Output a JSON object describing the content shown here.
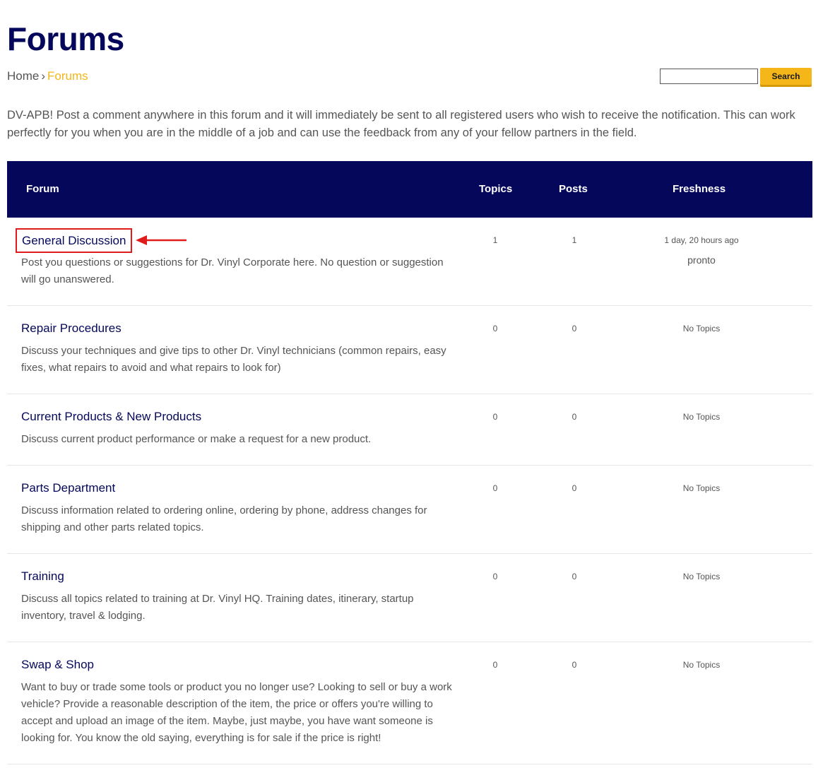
{
  "page": {
    "title": "Forums",
    "breadcrumb": {
      "home": "Home",
      "separator": "›",
      "current": "Forums"
    },
    "search": {
      "value": "",
      "button_label": "Search"
    },
    "intro": "DV-APB! Post a comment anywhere in this forum and it will immediately be sent to all registered users who wish to receive the notification. This can work perfectly for you when you are in the middle of a job and can use the feedback from any of your fellow partners in the field."
  },
  "table": {
    "headers": {
      "forum": "Forum",
      "topics": "Topics",
      "posts": "Posts",
      "freshness": "Freshness"
    },
    "rows": [
      {
        "title": "General Discussion",
        "description": "Post you questions or suggestions for Dr. Vinyl Corporate here. No question or suggestion will go unanswered.",
        "topics": "1",
        "posts": "1",
        "freshness": "1 day, 20 hours ago",
        "freshness_user": "pronto"
      },
      {
        "title": "Repair Procedures",
        "description": "Discuss your techniques and give tips to other Dr. Vinyl technicians (common repairs, easy fixes, what repairs to avoid and what repairs to look for)",
        "topics": "0",
        "posts": "0",
        "freshness": "No Topics"
      },
      {
        "title": "Current Products & New Products",
        "description": "Discuss current product performance or make a request for a new product.",
        "topics": "0",
        "posts": "0",
        "freshness": "No Topics"
      },
      {
        "title": "Parts Department",
        "description": "Discuss information related to ordering online, ordering by phone, address changes for shipping and other parts related topics.",
        "topics": "0",
        "posts": "0",
        "freshness": "No Topics"
      },
      {
        "title": "Training",
        "description": "Discuss all topics related to training at Dr. Vinyl HQ. Training dates, itinerary, startup inventory, travel & lodging.",
        "topics": "0",
        "posts": "0",
        "freshness": "No Topics"
      },
      {
        "title": "Swap & Shop",
        "description": "Want to buy or trade some tools or product you no longer use? Looking to sell or buy a work vehicle? Provide a reasonable description of the item, the price or offers you're willing to accept and upload an image of the item. Maybe, just maybe, you have want someone is looking for. You know the old saying, everything is for sale if the price is right!",
        "topics": "0",
        "posts": "0",
        "freshness": "No Topics"
      }
    ]
  },
  "annotation": {
    "highlight_color": "#e01b1b",
    "arrow_icon": "left-arrow-icon"
  },
  "colors": {
    "primary": "#05085a",
    "accent": "#f5b619"
  }
}
